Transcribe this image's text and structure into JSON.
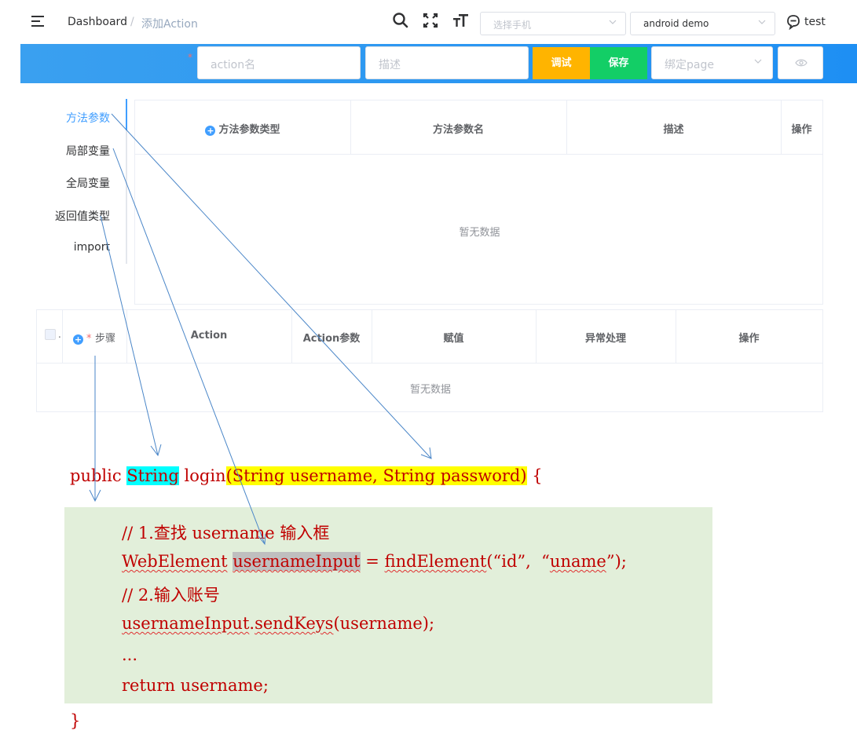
{
  "navbar": {
    "breadcrumb_home": "Dashboard",
    "breadcrumb_sep": "/",
    "breadcrumb_current": "添加Action",
    "phone_select_placeholder": "选择手机",
    "project_select_value": "android demo",
    "user_name": "test",
    "icons": [
      "menu-icon",
      "search-icon",
      "fullscreen-icon",
      "font-size-icon",
      "user-avatar-icon"
    ]
  },
  "toolbar": {
    "required_mark": "*",
    "action_name_placeholder": "action名",
    "description_placeholder": "描述",
    "debug_label": "调试",
    "save_label": "保存",
    "bind_page_placeholder": "绑定page",
    "debug_color": "#ffb400",
    "save_color": "#13ce66",
    "bar_color": "#1e8ff3"
  },
  "side_tabs": [
    {
      "label": "方法参数",
      "active": true
    },
    {
      "label": "局部变量",
      "active": false
    },
    {
      "label": "全局变量",
      "active": false
    },
    {
      "label": "返回值类型",
      "active": false
    },
    {
      "label": "import",
      "active": false
    }
  ],
  "params_table": {
    "headers": [
      "方法参数类型",
      "方法参数名",
      "描述",
      "操作"
    ],
    "empty_text": "暂无数据"
  },
  "steps_table": {
    "select_col_mark": ".",
    "required_mark": "*",
    "headers": [
      "步骤",
      "Action",
      "Action参数",
      "赋值",
      "异常处理",
      "操作"
    ],
    "empty_text": "暂无数据"
  },
  "code": {
    "l1_public": "public ",
    "l1_type": "String",
    "l1_name": " login",
    "l1_params": "(String username, String password)",
    "l1_brace": " {",
    "l2": "// 1.查找 username 输入框",
    "l3_type": "WebElement",
    "l3_var": "usernameInput",
    "l3_eq": " = ",
    "l3_fn": "findElement",
    "l3_args_a": "(“id”,  “",
    "l3_args_b": "uname",
    "l3_args_c": "”);",
    "l4": "// 2.输入账号",
    "l5_var": "usernameInput",
    "l5_dot": ".",
    "l5_fn": "sendKeys",
    "l5_rest": "(username);",
    "l6": "...",
    "l7": "return username;",
    "l8": "}"
  }
}
